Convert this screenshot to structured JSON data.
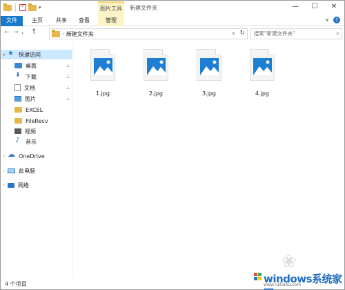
{
  "title_bar": {
    "picture_tools_tab": "图片工具",
    "window_title": "新建文件夹",
    "minimize_label": "—",
    "maximize_label": "☐",
    "close_label": "✕",
    "quick_access_dropdown": "▾"
  },
  "ribbon": {
    "tabs": [
      {
        "label": "文件"
      },
      {
        "label": "主页"
      },
      {
        "label": "共享"
      },
      {
        "label": "查看"
      },
      {
        "label": "管理"
      }
    ],
    "collapse_label": "∨",
    "help_label": "?"
  },
  "nav": {
    "back": "←",
    "forward": "→",
    "history": "▾",
    "up": "↑",
    "breadcrumb_separator": "›",
    "path": "新建文件夹",
    "refresh": "↻",
    "address_dropdown": "∨",
    "search_placeholder": "搜索\"新建文件夹\"",
    "search_icon": "⌕"
  },
  "sidebar": {
    "items": [
      {
        "label": "快速访问",
        "icon": "star-icon"
      },
      {
        "label": "桌面",
        "icon": "desktop-folder-icon",
        "pinned": true
      },
      {
        "label": "下载",
        "icon": "download-icon",
        "pinned": true
      },
      {
        "label": "文档",
        "icon": "document-icon",
        "pinned": true
      },
      {
        "label": "图片",
        "icon": "pictures-icon",
        "pinned": true
      },
      {
        "label": "EXCEL",
        "icon": "folder-icon"
      },
      {
        "label": "FileRecv",
        "icon": "folder-icon"
      },
      {
        "label": "视频",
        "icon": "video-icon"
      },
      {
        "label": "音乐",
        "icon": "music-icon"
      },
      {
        "label": "OneDrive",
        "icon": "onedrive-icon"
      },
      {
        "label": "此电脑",
        "icon": "this-pc-icon"
      },
      {
        "label": "网络",
        "icon": "network-icon"
      }
    ],
    "pin_glyph": "📌",
    "expand_glyph": "›"
  },
  "files": [
    {
      "name": "1.jpg"
    },
    {
      "name": "2.jpg"
    },
    {
      "name": "3.jpg"
    },
    {
      "name": "4.jpg"
    }
  ],
  "status": {
    "item_count": "4 个项目"
  },
  "watermark": {
    "brand": "windows系统家园",
    "url": "www.ruihaitu.com"
  },
  "colors": {
    "accent": "#1979ca",
    "tools_tab": "#fcf3c6",
    "selection": "#cce8ff",
    "image_icon": "#1e7fd2"
  }
}
